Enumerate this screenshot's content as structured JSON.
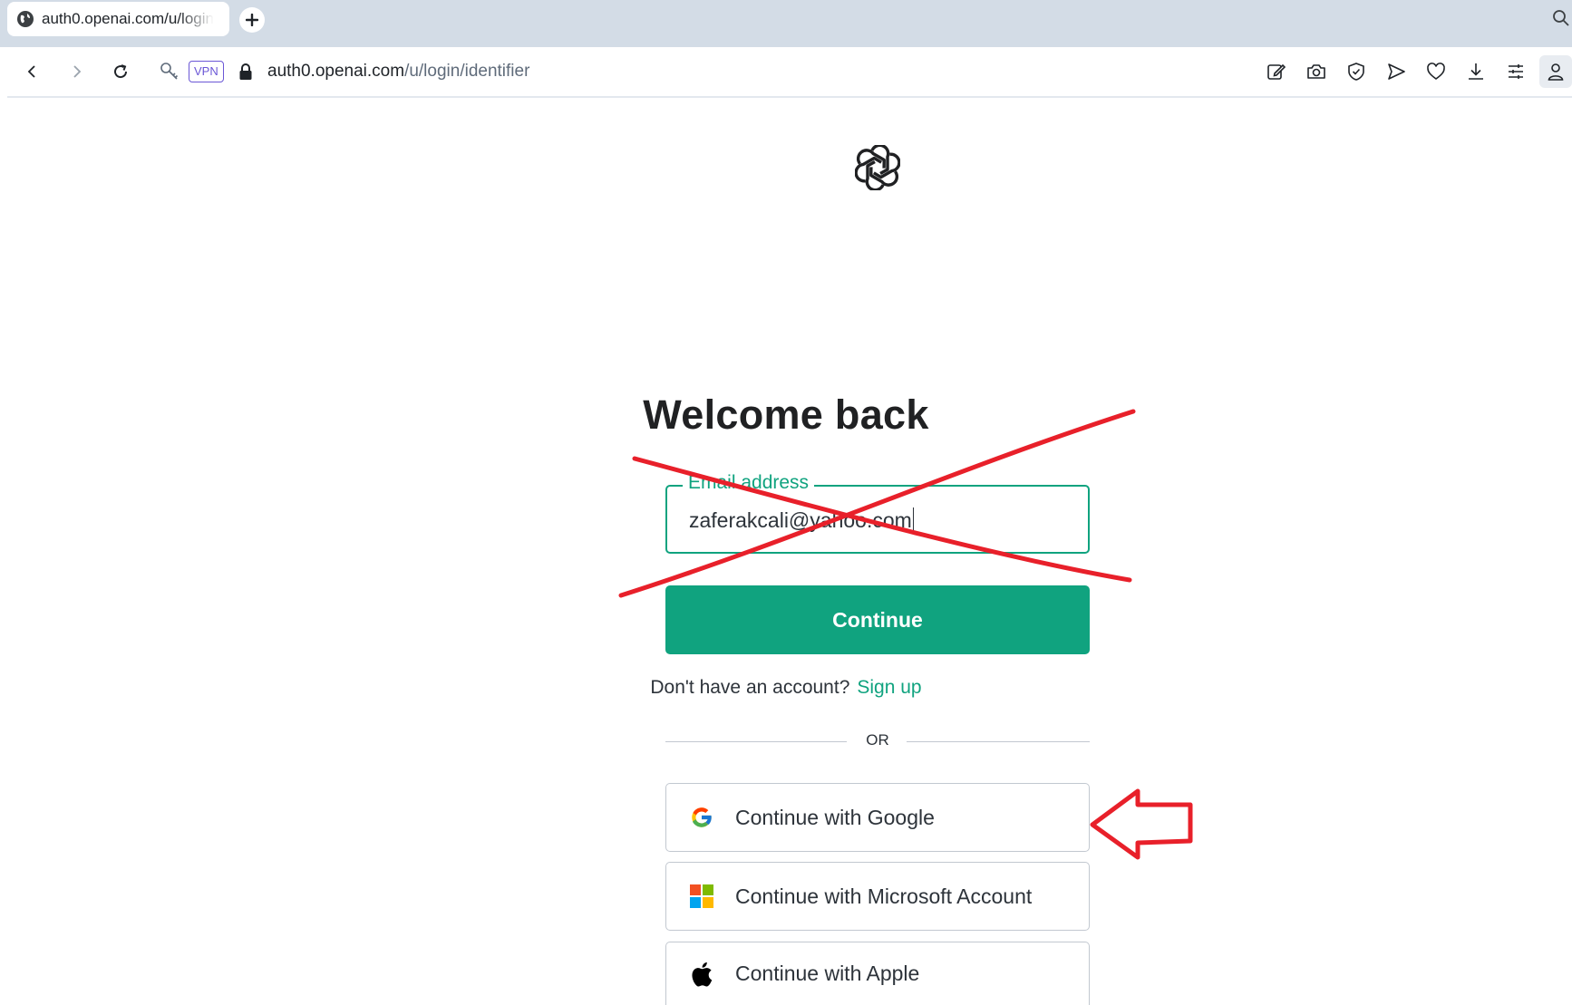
{
  "browser": {
    "tab_title": "auth0.openai.com/u/login",
    "new_tab_icon": "plus-icon",
    "vpn_label": "VPN",
    "url_host": "auth0.openai.com",
    "url_path": "/u/login/identifier",
    "toolbar_icons": [
      "back-icon",
      "forward-icon",
      "reload-icon",
      "key-icon",
      "lock-icon",
      "edit-icon",
      "camera-icon",
      "shield-icon",
      "send-icon",
      "heart-icon",
      "download-icon",
      "menu-icon",
      "profile-icon"
    ]
  },
  "page": {
    "logo": "openai-logo",
    "title": "Welcome back",
    "email_label": "Email address",
    "email_value": "zaferakcali@yahoo.com",
    "continue_label": "Continue",
    "no_account_text": "Don't have an account?",
    "signup_label": "Sign up",
    "or_text": "OR",
    "social_buttons": [
      {
        "label": "Continue with Google",
        "icon": "google-icon"
      },
      {
        "label": "Continue with Microsoft Account",
        "icon": "microsoft-icon"
      },
      {
        "label": "Continue with Apple",
        "icon": "apple-icon"
      }
    ]
  },
  "annotations": {
    "color": "#e8202a",
    "cross": "red X drawn over email field",
    "arrow": "red arrow pointing at Continue with Google"
  },
  "colors": {
    "accent": "#10a37f",
    "chrome": "#d3dce6",
    "vpn": "#6b57d6"
  }
}
